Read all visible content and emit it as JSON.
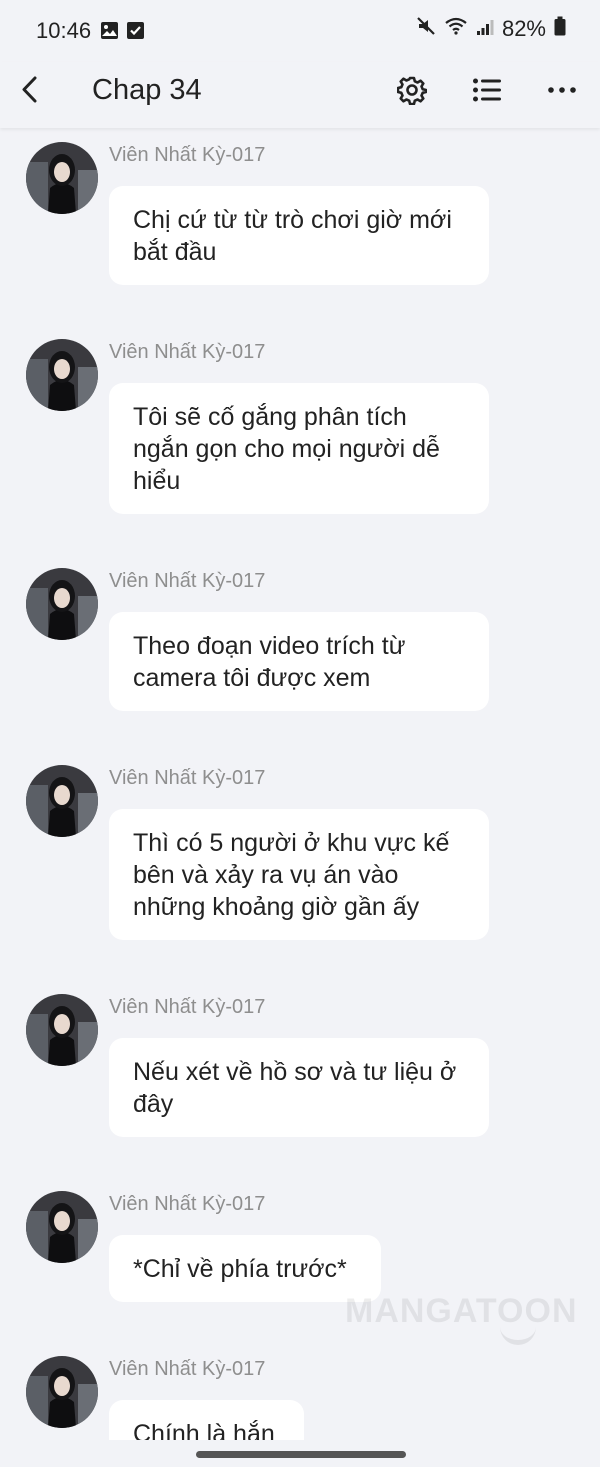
{
  "status_bar": {
    "time": "10:46",
    "battery": "82%",
    "left_icons": [
      "gallery-icon",
      "checkbox-icon"
    ],
    "right_icons": [
      "mute-icon",
      "wifi-icon",
      "signal-icon",
      "battery-icon"
    ]
  },
  "nav": {
    "title": "Chap 34",
    "icons": [
      "back-arrow-icon",
      "settings-gear-icon",
      "list-icon",
      "more-dots-icon"
    ]
  },
  "messages": [
    {
      "sender": "Viên Nhất Kỳ-017",
      "text": "Chị cứ từ từ trò chơi giờ mới bắt đầu"
    },
    {
      "sender": "Viên Nhất Kỳ-017",
      "text": "Tôi sẽ cố gắng phân tích ngắn gọn cho mọi người dễ hiểu"
    },
    {
      "sender": "Viên Nhất Kỳ-017",
      "text": "Theo đoạn video trích từ camera tôi được xem"
    },
    {
      "sender": "Viên Nhất Kỳ-017",
      "text": "Thì có 5 người ở khu vực kế bên và xảy ra vụ án vào những khoảng giờ gần ấy"
    },
    {
      "sender": "Viên Nhất Kỳ-017",
      "text": "Nếu xét về hồ sơ và tư liệu ở đây"
    },
    {
      "sender": "Viên Nhất Kỳ-017",
      "text": "*Chỉ về phía trước*"
    },
    {
      "sender": "Viên Nhất Kỳ-017",
      "text": "Chính là hắn"
    }
  ],
  "watermark": "MANGATOON",
  "colors": {
    "background": "#f2f3f7",
    "bubble": "#ffffff",
    "sender_text": "#8e8e8e",
    "text": "#222222"
  }
}
